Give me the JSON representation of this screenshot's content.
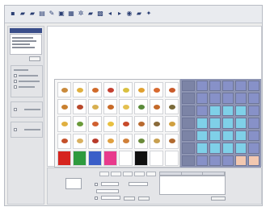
{
  "toolbar": {
    "buttons": [
      {
        "name": "new-icon",
        "glyph": "▪"
      },
      {
        "name": "open-icon",
        "glyph": "▰"
      },
      {
        "name": "save-icon",
        "glyph": "▰"
      },
      {
        "name": "copy-icon",
        "glyph": "▤"
      },
      {
        "name": "pencil-icon",
        "glyph": "✎"
      },
      {
        "name": "image-icon",
        "glyph": "▣"
      },
      {
        "name": "grid-icon",
        "glyph": "▦"
      },
      {
        "name": "settings-icon",
        "glyph": "✲"
      },
      {
        "name": "folder-icon",
        "glyph": "▰"
      },
      {
        "name": "layout-icon",
        "glyph": "▩"
      },
      {
        "name": "arrow-left-icon",
        "glyph": "◂"
      },
      {
        "name": "arrow-right-icon",
        "glyph": "▸"
      },
      {
        "name": "zoom-icon",
        "glyph": "◉"
      },
      {
        "name": "print-icon",
        "glyph": "▰"
      },
      {
        "name": "help-icon",
        "glyph": "✦"
      }
    ]
  },
  "left_panel": {
    "button_label": "",
    "group_labels": [
      "",
      ""
    ]
  },
  "grid": {
    "rows": [
      [
        "#c98a3c",
        "#e0b040",
        "#d06a2a",
        "#c44030",
        "#d9c040",
        "#e0a030",
        "#d86a30",
        "#c95a2a"
      ],
      [
        "#c9802f",
        "#b8482a",
        "#d8b050",
        "#c86a28",
        "#e4c050",
        "#5a8a3a",
        "#c46a2a",
        "#7a6a3a"
      ],
      [
        "#e0b040",
        "#6a9a3a",
        "#d06030",
        "#e8c040",
        "#c84a2a",
        "#b86a30",
        "#8a6a3a",
        "#d0a040"
      ],
      [
        "#c4502a",
        "#d9b060",
        "#b83a2a",
        "#e0a040",
        "#d0803a",
        "#6a8a3a",
        "#c8a050",
        "#b06a30"
      ],
      [
        "#d6241e",
        "#2e9a3e",
        "#3a5ec8",
        "#e83a8c",
        "#ffffff",
        "#101010",
        "#ffffff",
        "#ffffff"
      ]
    ],
    "row5_swatch_mode": true
  },
  "key_panel": {
    "rows": [
      [
        "#7c84a6",
        "#8791c8",
        "#8791c8",
        "#8791c8",
        "#8791c8",
        "#8791c8"
      ],
      [
        "#7c84a6",
        "#8791c8",
        "#8791c8",
        "#8791c8",
        "#8791c8",
        "#8791c8"
      ],
      [
        "#7c84a6",
        "#8791c8",
        "#7fd0e8",
        "#7fd0e8",
        "#7fd0e8",
        "#8791c8"
      ],
      [
        "#7c84a6",
        "#7fd0e8",
        "#7fd0e8",
        "#7fd0e8",
        "#7fd0e8",
        "#8791c8"
      ],
      [
        "#7c84a6",
        "#7fd0e8",
        "#7fd0e8",
        "#7fd0e8",
        "#7fd0e8",
        "#8791c8"
      ],
      [
        "#7c84a6",
        "#7fd0e8",
        "#7fd0e8",
        "#7fd0e8",
        "#7fd0e8",
        "#8791c8"
      ],
      [
        "#7c84a6",
        "#8791c8",
        "#8791c8",
        "#8791c8",
        "#f2c8b0",
        "#f2c8b0"
      ]
    ]
  },
  "bottom": {
    "list_headers": [
      "",
      "",
      ""
    ],
    "buttons": [
      "",
      "",
      ""
    ]
  }
}
